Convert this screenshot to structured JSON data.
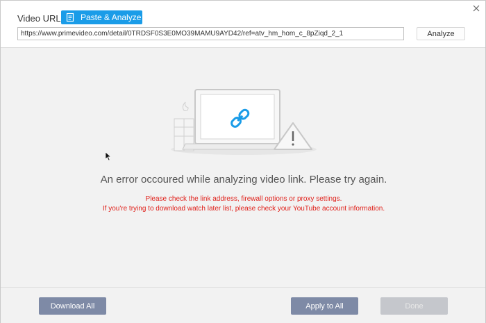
{
  "header": {
    "url_label": "Video URL:",
    "paste_label": "Paste & Analyze",
    "url_value": "https://www.primevideo.com/detail/0TRDSF0S3E0MO39MAMU9AYD42/ref=atv_hm_hom_c_8pZiqd_2_1",
    "analyze_label": "Analyze"
  },
  "error": {
    "title": "An error occoured while analyzing video link. Please try again.",
    "line1": "Please check the link address, firewall options or proxy settings.",
    "line2": "If you're trying to download watch later list, please check your YouTube account information."
  },
  "footer": {
    "download_all": "Download All",
    "apply_to_all": "Apply to All",
    "done": "Done"
  },
  "colors": {
    "accent": "#1a9ce8",
    "error_red": "#e0201a",
    "button_gray": "#7e8aa6"
  },
  "icons": {
    "paste": "clipboard-icon",
    "close": "close-icon",
    "link": "chain-link-icon",
    "warning": "warning-triangle-icon"
  }
}
